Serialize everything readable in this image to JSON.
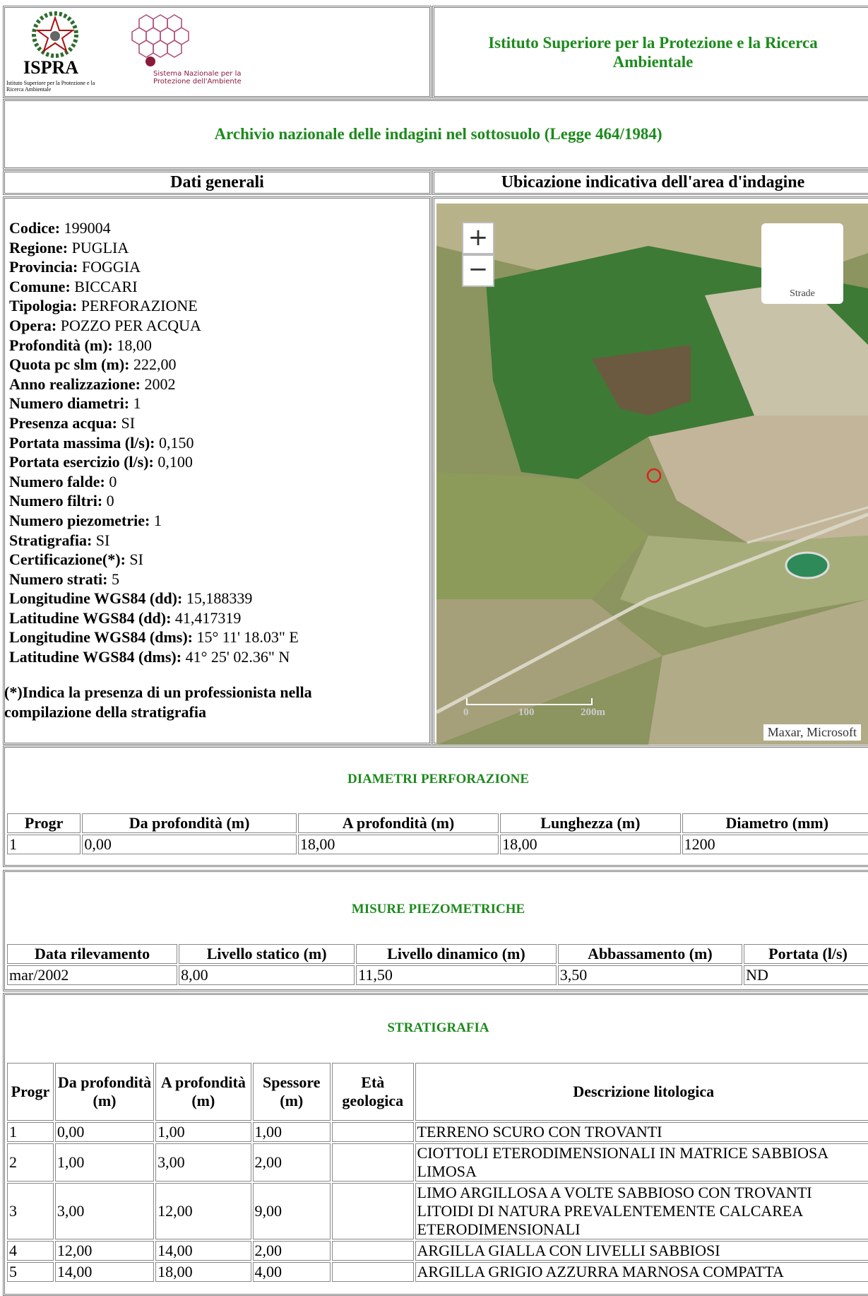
{
  "header": {
    "logo_text": "ISPRA",
    "logo_subtext": "Istituto Superiore per la Protezione e la Ricerca Ambientale",
    "snpa_text": "Sistema Nazionale per la Protezione dell'Ambiente",
    "institute": "Istituto Superiore per la Protezione e la Ricerca Ambientale",
    "archive_title": "Archivio nazionale delle indagini nel sottosuolo (Legge 464/1984)"
  },
  "sections": {
    "general": "Dati generali",
    "location": "Ubicazione indicativa dell'area d'indagine"
  },
  "info": [
    {
      "label": "Codice:",
      "value": "199004"
    },
    {
      "label": "Regione:",
      "value": "PUGLIA"
    },
    {
      "label": "Provincia:",
      "value": "FOGGIA"
    },
    {
      "label": "Comune:",
      "value": "BICCARI"
    },
    {
      "label": "Tipologia:",
      "value": "PERFORAZIONE"
    },
    {
      "label": "Opera:",
      "value": "POZZO PER ACQUA"
    },
    {
      "label": "Profondità (m):",
      "value": "18,00"
    },
    {
      "label": "Quota pc slm (m):",
      "value": "222,00"
    },
    {
      "label": "Anno realizzazione:",
      "value": "2002"
    },
    {
      "label": "Numero diametri:",
      "value": "1"
    },
    {
      "label": "Presenza acqua:",
      "value": "SI"
    },
    {
      "label": "Portata massima (l/s):",
      "value": "0,150"
    },
    {
      "label": "Portata esercizio (l/s):",
      "value": "0,100"
    },
    {
      "label": "Numero falde:",
      "value": "0"
    },
    {
      "label": "Numero filtri:",
      "value": "0"
    },
    {
      "label": "Numero piezometrie:",
      "value": "1"
    },
    {
      "label": "Stratigrafia:",
      "value": "SI"
    },
    {
      "label": "Certificazione(*):",
      "value": "SI"
    },
    {
      "label": "Numero strati:",
      "value": "5"
    },
    {
      "label": "Longitudine WGS84 (dd):",
      "value": "15,188339"
    },
    {
      "label": "Latitudine WGS84 (dd):",
      "value": "41,417319"
    },
    {
      "label": "Longitudine WGS84 (dms):",
      "value": "15° 11' 18.03\" E"
    },
    {
      "label": "Latitudine WGS84 (dms):",
      "value": "41° 25' 02.36\" N"
    }
  ],
  "note": "(*)Indica la presenza di un professionista nella compilazione della stratigrafia",
  "map": {
    "zoom_in": "+",
    "zoom_out": "−",
    "layer_label": "Strade",
    "attribution": "Maxar, Microsoft",
    "scale_labels": [
      "0",
      "100",
      "200m"
    ]
  },
  "diametri": {
    "title": "DIAMETRI PERFORAZIONE",
    "headers": [
      "Progr",
      "Da profondità (m)",
      "A profondità (m)",
      "Lunghezza (m)",
      "Diametro (mm)"
    ],
    "rows": [
      [
        "1",
        "0,00",
        "18,00",
        "18,00",
        "1200"
      ]
    ]
  },
  "piezo": {
    "title": "MISURE PIEZOMETRICHE",
    "headers": [
      "Data rilevamento",
      "Livello statico (m)",
      "Livello dinamico (m)",
      "Abbassamento (m)",
      "Portata (l/s)"
    ],
    "rows": [
      [
        "mar/2002",
        "8,00",
        "11,50",
        "3,50",
        "ND"
      ]
    ]
  },
  "strati": {
    "title": "STRATIGRAFIA",
    "headers": [
      "Progr",
      "Da profondità (m)",
      "A profondità (m)",
      "Spessore (m)",
      "Età geologica",
      "Descrizione litologica"
    ],
    "rows": [
      [
        "1",
        "0,00",
        "1,00",
        "1,00",
        "",
        "TERRENO SCURO CON TROVANTI"
      ],
      [
        "2",
        "1,00",
        "3,00",
        "2,00",
        "",
        "CIOTTOLI ETERODIMENSIONALI IN MATRICE SABBIOSA LIMOSA"
      ],
      [
        "3",
        "3,00",
        "12,00",
        "9,00",
        "",
        "LIMO ARGILLOSA A VOLTE SABBIOSO CON TROVANTI LITOIDI DI NATURA PREVALENTEMENTE CALCAREA ETERODIMENSIONALI"
      ],
      [
        "4",
        "12,00",
        "14,00",
        "2,00",
        "",
        "ARGILLA GIALLA CON LIVELLI SABBIOSI"
      ],
      [
        "5",
        "14,00",
        "18,00",
        "4,00",
        "",
        "ARGILLA GRIGIO AZZURRA MARNOSA COMPATTA"
      ]
    ]
  }
}
